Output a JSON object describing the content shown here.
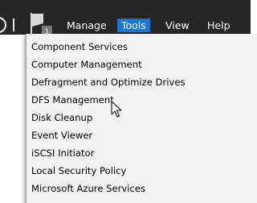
{
  "menubar": {
    "items": [
      {
        "label": "Manage",
        "active": false
      },
      {
        "label": "Tools",
        "active": true
      },
      {
        "label": "View",
        "active": false
      },
      {
        "label": "Help",
        "active": false
      }
    ],
    "notification_count": "1",
    "accent_color": "#1976d2",
    "background_color": "#262626"
  },
  "icons": {
    "back": "back-icon",
    "flag": "notifications-flag-icon",
    "cursor": "mouse-pointer-icon"
  },
  "tools_menu": {
    "items": [
      "Component Services",
      "Computer Management",
      "Defragment and Optimize Drives",
      "DFS Management",
      "Disk Cleanup",
      "Event Viewer",
      "iSCSI Initiator",
      "Local Security Policy",
      "Microsoft Azure Services"
    ],
    "background_color": "#f2f2f2"
  }
}
